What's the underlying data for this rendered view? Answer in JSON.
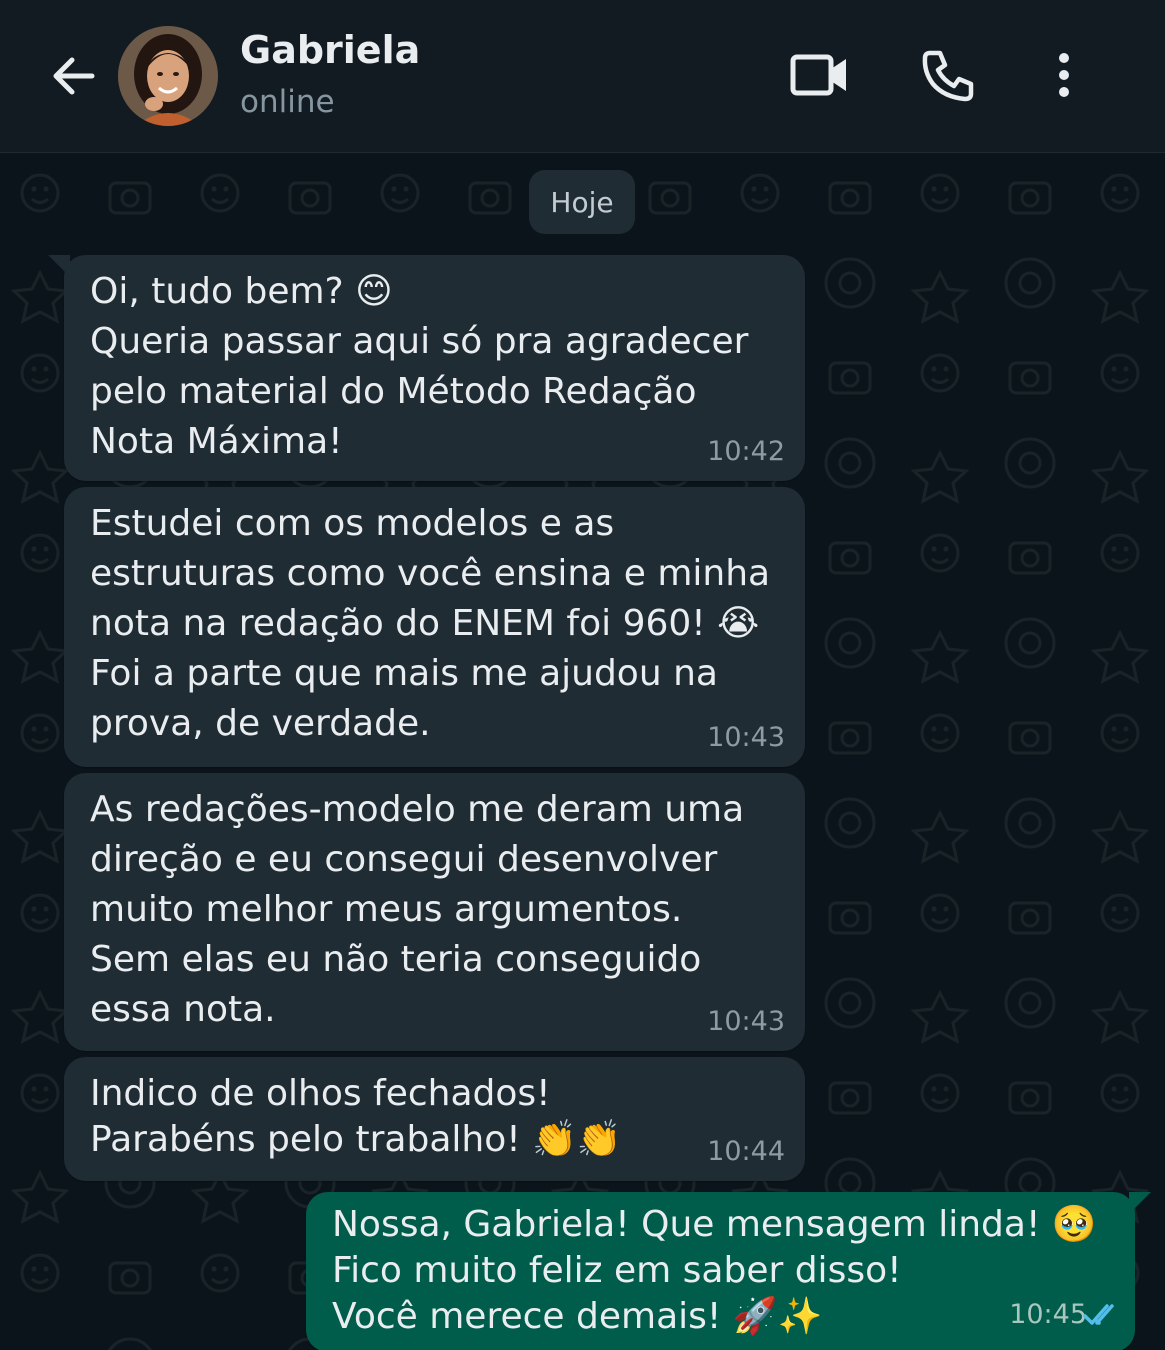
{
  "header": {
    "contact_name": "Gabriela",
    "status": "online",
    "icons": [
      "back-arrow-icon",
      "video-call-icon",
      "phone-icon",
      "more-options-icon"
    ]
  },
  "chat": {
    "date_chip": "Hoje",
    "messages": [
      {
        "direction": "incoming",
        "lines": [
          "Oi, tudo bem? 😊",
          "Queria passar aqui só pra agradecer",
          "pelo material do Método Redação",
          "Nota Máxima!"
        ],
        "time": "10:42"
      },
      {
        "direction": "incoming",
        "lines": [
          "Estudei com os modelos e as",
          "estruturas como você ensina e minha",
          "nota na redação do ENEM foi 960! 😭",
          "Foi a parte que mais me ajudou na",
          "prova, de verdade."
        ],
        "time": "10:43"
      },
      {
        "direction": "incoming",
        "lines": [
          "As redações-modelo me deram uma",
          "direção e eu consegui desenvolver",
          "muito melhor meus argumentos.",
          "Sem elas eu não teria conseguido",
          "essa nota."
        ],
        "time": "10:43"
      },
      {
        "direction": "incoming",
        "lines": [
          "Indico de olhos fechados!",
          "Parabéns pelo trabalho! 👏👏"
        ],
        "time": "10:44"
      },
      {
        "direction": "outgoing",
        "lines": [
          "Nossa, Gabriela! Que mensagem linda! 🥹",
          "Fico muito feliz em saber disso!",
          "Você merece demais! 🚀✨"
        ],
        "time": "10:45",
        "read_status": "read"
      }
    ]
  },
  "colors": {
    "header_bg": "#111b21",
    "chat_bg": "#0b141a",
    "incoming_bubble": "#202c33",
    "outgoing_bubble": "#005c4b",
    "read_ticks": "#53bdeb"
  }
}
